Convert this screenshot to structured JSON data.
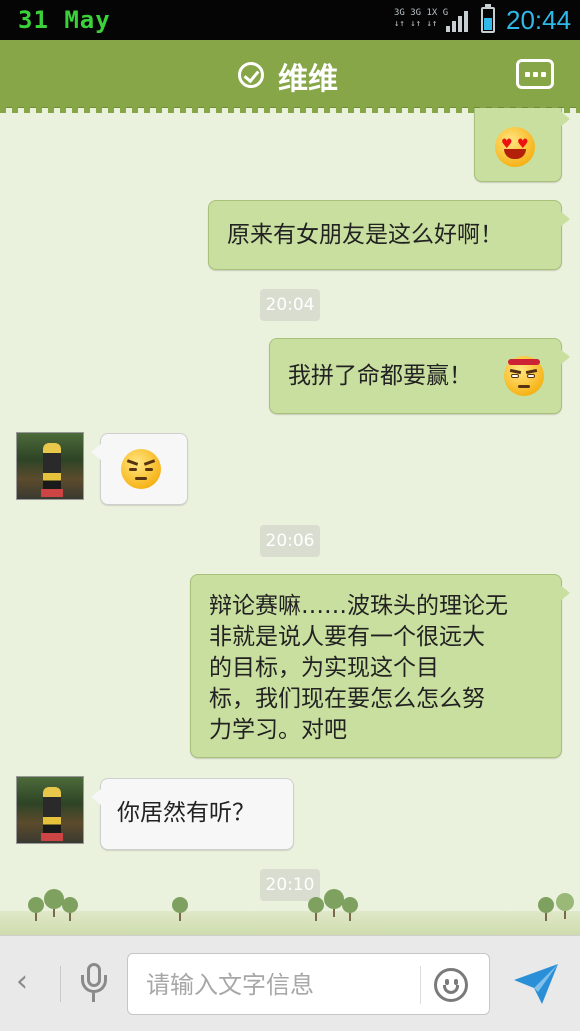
{
  "status_bar": {
    "date": "31 May",
    "network_top": "3G 3G 1X G",
    "network_bottom": "↓↑ ↓↑ ↓↑",
    "time": "20:44",
    "battery_level": 0.55,
    "icons": [
      "signal-icon",
      "battery-icon"
    ]
  },
  "header": {
    "title": "维维",
    "status_icon": "check-circle-icon",
    "menu_icon": "more-dots-icon"
  },
  "messages": [
    {
      "side": "out",
      "type": "emoji",
      "emoji": "heart-eyes-emoji"
    },
    {
      "side": "out",
      "type": "text",
      "text": "原来有女朋友是这么好啊！"
    },
    {
      "type": "timestamp",
      "text": "20:04"
    },
    {
      "side": "out",
      "type": "text",
      "text": "我拼了命都要赢！",
      "emoji": "determined-headband-emoji"
    },
    {
      "side": "in",
      "type": "emoji",
      "emoji": "sulking-emoji"
    },
    {
      "type": "timestamp",
      "text": "20:06"
    },
    {
      "side": "out",
      "type": "text",
      "lines": [
        "辩论赛嘛……波珠头的理论无",
        "非就是说人要有一个很远大",
        "的目标，为实现这个目",
        "标，我们现在要怎么怎么努",
        "力学习。对吧"
      ]
    },
    {
      "side": "in",
      "type": "text",
      "text": "你居然有听？"
    },
    {
      "type": "timestamp",
      "text": "20:10"
    }
  ],
  "input_bar": {
    "back_icon": "chevron-left-icon",
    "back_glyph": "‹",
    "voice_icon": "microphone-icon",
    "placeholder": "请输入文字信息",
    "emoji_icon": "smiley-icon",
    "send_icon": "send-icon"
  },
  "colors": {
    "header": "#86a648",
    "chat_bg": "#eaf1dc",
    "outgoing_bubble": "#c9df9f",
    "incoming_bubble": "#f7f7f7",
    "date_green": "#3bd13a",
    "time_blue": "#2fb8e8",
    "send_blue": "#2a8fd6"
  }
}
